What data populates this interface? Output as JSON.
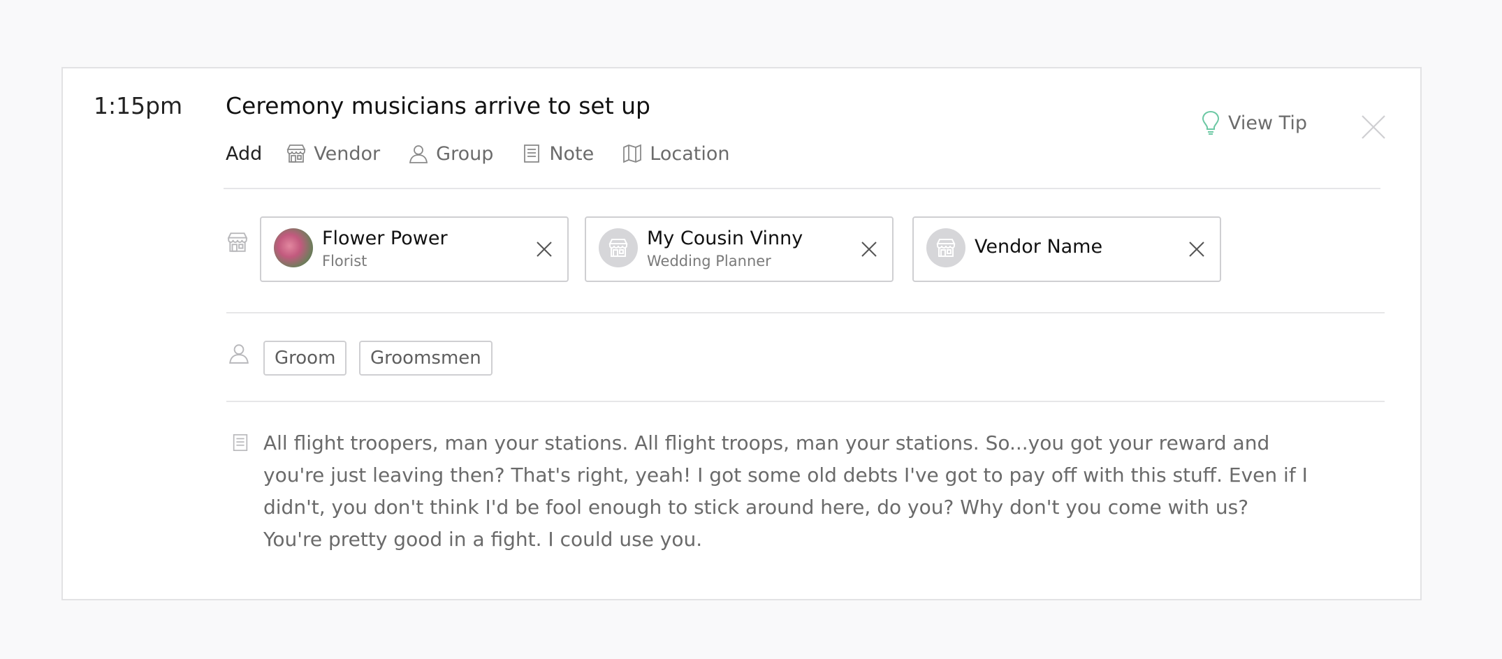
{
  "event": {
    "time": "1:15pm",
    "title": "Ceremony musicians arrive to set up"
  },
  "add_bar": {
    "label": "Add",
    "items": [
      {
        "label": "Vendor",
        "icon": "store-icon"
      },
      {
        "label": "Group",
        "icon": "person-icon"
      },
      {
        "label": "Note",
        "icon": "note-icon"
      },
      {
        "label": "Location",
        "icon": "map-icon"
      }
    ]
  },
  "view_tip": {
    "label": "View Tip",
    "icon": "lightbulb-icon",
    "color": "#6cc8a4"
  },
  "vendors": [
    {
      "name": "Flower Power",
      "role": "Florist",
      "avatar": "photo"
    },
    {
      "name": "My Cousin Vinny",
      "role": "Wedding Planner",
      "avatar": "store-icon"
    },
    {
      "name": "Vendor Name",
      "role": "",
      "avatar": "store-icon"
    }
  ],
  "groups": [
    "Groom",
    "Groomsmen"
  ],
  "note": {
    "text": "All flight troopers, man your stations. All flight troops, man your stations. So...you got your reward and you're just leaving then? That's right, yeah! I got some old debts I've got to pay off with this stuff. Even if I didn't, you don't think I'd be fool enough to stick around here, do you? Why don't you come with us? You're pretty good in a fight. I could use you."
  },
  "colors": {
    "background": "#f9f9fa",
    "card_border": "#e2e2e4",
    "chip_border": "#cfcfd2",
    "muted_text": "#6a6a6a",
    "tip_accent": "#6cc8a4"
  }
}
